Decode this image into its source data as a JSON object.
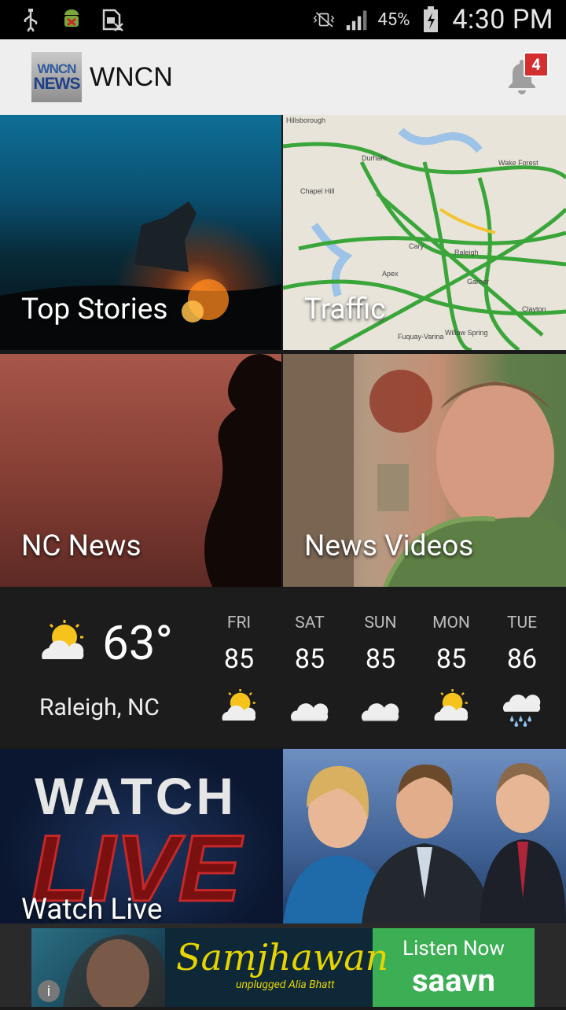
{
  "status_bar": {
    "battery_percent": "45%",
    "time": "4:30 PM",
    "icons": [
      "usb-icon",
      "android-debug-icon",
      "sim-card-icon",
      "vibrate-icon",
      "signal-icon",
      "battery-charging-icon"
    ]
  },
  "app_bar": {
    "logo_line1": "WNCN",
    "logo_line2": "NEWS",
    "title": "WNCN",
    "notification_count": "4"
  },
  "tiles": {
    "top_stories": "Top Stories",
    "traffic": "Traffic",
    "nc_news": "NC News",
    "news_videos": "News Videos",
    "watch_live": "Watch Live"
  },
  "traffic_map_labels": [
    "Hillsborough",
    "Durham",
    "Chapel Hill",
    "Wake Forest",
    "Cary",
    "Raleigh",
    "Apex",
    "Garner",
    "Fuquay-Varina",
    "Willow Spring",
    "Clayton"
  ],
  "weather": {
    "current_temp": "63°",
    "location": "Raleigh, NC",
    "current_icon": "partly-sunny-icon",
    "forecast": [
      {
        "day": "FRI",
        "temp": "85",
        "icon": "partly-sunny-icon"
      },
      {
        "day": "SAT",
        "temp": "85",
        "icon": "cloudy-icon"
      },
      {
        "day": "SUN",
        "temp": "85",
        "icon": "cloudy-icon"
      },
      {
        "day": "MON",
        "temp": "85",
        "icon": "partly-sunny-icon"
      },
      {
        "day": "TUE",
        "temp": "86",
        "icon": "rain-icon"
      }
    ]
  },
  "watch_live_graphic": {
    "word1": "WATCH",
    "word2": "LIVE"
  },
  "ad": {
    "title": "Samjhawan",
    "subtitle": "unplugged Alia Bhatt",
    "cta": "Listen Now",
    "brand": "saavn",
    "info": "i"
  },
  "colors": {
    "app_bar": "#eeeeee",
    "badge": "#d32f2f",
    "weather_bg": "#1c1c1c",
    "ad_green": "#3cae54"
  }
}
